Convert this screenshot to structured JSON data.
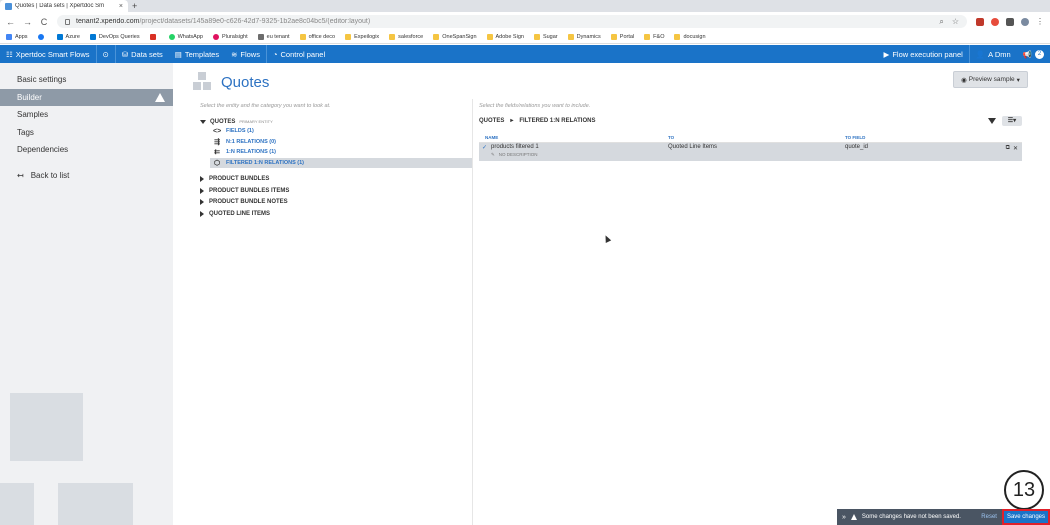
{
  "browser": {
    "tab_title": "Quotes | Data sets | Xpertdoc Sm",
    "tab_close": "×",
    "new_tab": "+",
    "url_host": "tenant2.xperido.com",
    "url_path": "/project/datasets/145a89e0-c626-42d7-9325-1b2ae8c04bc5/(editor:layout)",
    "nav_back": "←",
    "nav_forward": "→",
    "nav_reload": "C",
    "nav_home": "⌂",
    "bookmarks": [
      "Apps",
      "",
      "Azure",
      "DevOps Queries",
      "",
      "WhatsApp",
      "Pluralsight",
      "eu tenant",
      "office deco",
      "Expeilogix",
      "salesforce",
      "OneSpanSign",
      "Adobe Sign",
      "Sugar",
      "Dynamics",
      "Portal",
      "F&O",
      "docusign"
    ]
  },
  "appbar": {
    "brand": "Xpertdoc Smart Flows",
    "data_sets": "Data sets",
    "templates": "Templates",
    "flows": "Flows",
    "control_panel": "Control panel",
    "flow_execution": "Flow execution panel",
    "user": "A Dmn",
    "notif_count": "2"
  },
  "sidebar": {
    "items": [
      "Basic settings",
      "Builder",
      "Samples",
      "Tags",
      "Dependencies"
    ],
    "back": "Back to list"
  },
  "main": {
    "title": "Quotes",
    "preview_btn": "Preview sample",
    "left_hint": "Select the entity and the category you want to look at.",
    "root_label": "QUOTES",
    "root_badge": "PRIMARY ENTITY",
    "root_children": [
      "FIELDS (1)",
      "N:1 RELATIONS (0)",
      "1:N RELATIONS (1)",
      "FILTERED 1:N RELATIONS (1)"
    ],
    "groups": [
      "PRODUCT BUNDLES",
      "PRODUCT BUNDLES ITEMS",
      "PRODUCT BUNDLE NOTES",
      "QUOTED LINE ITEMS"
    ],
    "right_hint": "Select the fields/relations you want to include.",
    "crumb_1": "QUOTES",
    "crumb_2": "FILTERED 1:N RELATIONS",
    "columns": [
      "NAME",
      "TO",
      "TO FIELD"
    ],
    "rows": [
      {
        "name": "products filtered 1",
        "to": "Quoted Line Items",
        "to_field": "quote_id",
        "desc": "NO DESCRIPTION"
      }
    ]
  },
  "annotation": {
    "step": "13"
  },
  "notice": {
    "message": "Some changes have not been saved.",
    "reset": "Reset",
    "save": "Save changes"
  },
  "colors": {
    "accent": "#1a73c8",
    "title_blue": "#2d72c2",
    "sidebar_active": "#8e9aa7",
    "save_outline": "#e0202a"
  }
}
